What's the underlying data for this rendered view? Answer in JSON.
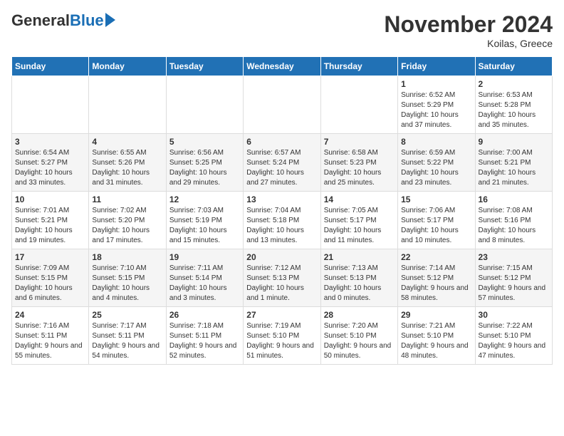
{
  "header": {
    "logo_general": "General",
    "logo_blue": "Blue",
    "month_title": "November 2024",
    "location": "Koilas, Greece"
  },
  "weekdays": [
    "Sunday",
    "Monday",
    "Tuesday",
    "Wednesday",
    "Thursday",
    "Friday",
    "Saturday"
  ],
  "weeks": [
    [
      {
        "day": "",
        "info": ""
      },
      {
        "day": "",
        "info": ""
      },
      {
        "day": "",
        "info": ""
      },
      {
        "day": "",
        "info": ""
      },
      {
        "day": "",
        "info": ""
      },
      {
        "day": "1",
        "info": "Sunrise: 6:52 AM\nSunset: 5:29 PM\nDaylight: 10 hours and 37 minutes."
      },
      {
        "day": "2",
        "info": "Sunrise: 6:53 AM\nSunset: 5:28 PM\nDaylight: 10 hours and 35 minutes."
      }
    ],
    [
      {
        "day": "3",
        "info": "Sunrise: 6:54 AM\nSunset: 5:27 PM\nDaylight: 10 hours and 33 minutes."
      },
      {
        "day": "4",
        "info": "Sunrise: 6:55 AM\nSunset: 5:26 PM\nDaylight: 10 hours and 31 minutes."
      },
      {
        "day": "5",
        "info": "Sunrise: 6:56 AM\nSunset: 5:25 PM\nDaylight: 10 hours and 29 minutes."
      },
      {
        "day": "6",
        "info": "Sunrise: 6:57 AM\nSunset: 5:24 PM\nDaylight: 10 hours and 27 minutes."
      },
      {
        "day": "7",
        "info": "Sunrise: 6:58 AM\nSunset: 5:23 PM\nDaylight: 10 hours and 25 minutes."
      },
      {
        "day": "8",
        "info": "Sunrise: 6:59 AM\nSunset: 5:22 PM\nDaylight: 10 hours and 23 minutes."
      },
      {
        "day": "9",
        "info": "Sunrise: 7:00 AM\nSunset: 5:21 PM\nDaylight: 10 hours and 21 minutes."
      }
    ],
    [
      {
        "day": "10",
        "info": "Sunrise: 7:01 AM\nSunset: 5:21 PM\nDaylight: 10 hours and 19 minutes."
      },
      {
        "day": "11",
        "info": "Sunrise: 7:02 AM\nSunset: 5:20 PM\nDaylight: 10 hours and 17 minutes."
      },
      {
        "day": "12",
        "info": "Sunrise: 7:03 AM\nSunset: 5:19 PM\nDaylight: 10 hours and 15 minutes."
      },
      {
        "day": "13",
        "info": "Sunrise: 7:04 AM\nSunset: 5:18 PM\nDaylight: 10 hours and 13 minutes."
      },
      {
        "day": "14",
        "info": "Sunrise: 7:05 AM\nSunset: 5:17 PM\nDaylight: 10 hours and 11 minutes."
      },
      {
        "day": "15",
        "info": "Sunrise: 7:06 AM\nSunset: 5:17 PM\nDaylight: 10 hours and 10 minutes."
      },
      {
        "day": "16",
        "info": "Sunrise: 7:08 AM\nSunset: 5:16 PM\nDaylight: 10 hours and 8 minutes."
      }
    ],
    [
      {
        "day": "17",
        "info": "Sunrise: 7:09 AM\nSunset: 5:15 PM\nDaylight: 10 hours and 6 minutes."
      },
      {
        "day": "18",
        "info": "Sunrise: 7:10 AM\nSunset: 5:15 PM\nDaylight: 10 hours and 4 minutes."
      },
      {
        "day": "19",
        "info": "Sunrise: 7:11 AM\nSunset: 5:14 PM\nDaylight: 10 hours and 3 minutes."
      },
      {
        "day": "20",
        "info": "Sunrise: 7:12 AM\nSunset: 5:13 PM\nDaylight: 10 hours and 1 minute."
      },
      {
        "day": "21",
        "info": "Sunrise: 7:13 AM\nSunset: 5:13 PM\nDaylight: 10 hours and 0 minutes."
      },
      {
        "day": "22",
        "info": "Sunrise: 7:14 AM\nSunset: 5:12 PM\nDaylight: 9 hours and 58 minutes."
      },
      {
        "day": "23",
        "info": "Sunrise: 7:15 AM\nSunset: 5:12 PM\nDaylight: 9 hours and 57 minutes."
      }
    ],
    [
      {
        "day": "24",
        "info": "Sunrise: 7:16 AM\nSunset: 5:11 PM\nDaylight: 9 hours and 55 minutes."
      },
      {
        "day": "25",
        "info": "Sunrise: 7:17 AM\nSunset: 5:11 PM\nDaylight: 9 hours and 54 minutes."
      },
      {
        "day": "26",
        "info": "Sunrise: 7:18 AM\nSunset: 5:11 PM\nDaylight: 9 hours and 52 minutes."
      },
      {
        "day": "27",
        "info": "Sunrise: 7:19 AM\nSunset: 5:10 PM\nDaylight: 9 hours and 51 minutes."
      },
      {
        "day": "28",
        "info": "Sunrise: 7:20 AM\nSunset: 5:10 PM\nDaylight: 9 hours and 50 minutes."
      },
      {
        "day": "29",
        "info": "Sunrise: 7:21 AM\nSunset: 5:10 PM\nDaylight: 9 hours and 48 minutes."
      },
      {
        "day": "30",
        "info": "Sunrise: 7:22 AM\nSunset: 5:10 PM\nDaylight: 9 hours and 47 minutes."
      }
    ]
  ]
}
